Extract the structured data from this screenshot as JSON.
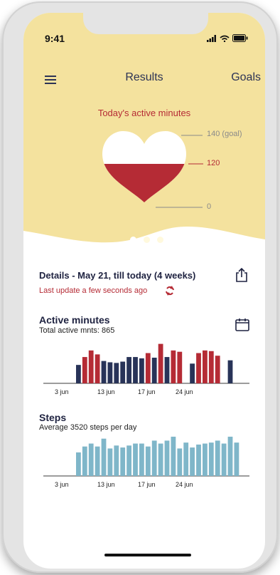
{
  "status": {
    "time": "9:41"
  },
  "nav": {
    "title": "Results",
    "goals_label": "Goals"
  },
  "hero": {
    "title": "Today's active minutes",
    "goal_label": "140 (goal)",
    "current_label": "120",
    "zero_label": "0",
    "current_value": 120,
    "goal_value": 140,
    "pages": 3,
    "active_page": 0
  },
  "details": {
    "title": "Details - May 21, till today (4 weeks)",
    "update": "Last update a few seconds ago"
  },
  "active": {
    "title": "Active minutes",
    "subtitle": "Total active mnts: 865"
  },
  "steps": {
    "title": "Steps",
    "subtitle": "Average 3520 steps per day"
  },
  "colors": {
    "hero_bg": "#f4e29e",
    "red": "#b52b35",
    "navy": "#283358",
    "teal": "#7fb6c9"
  },
  "chart_data": [
    {
      "type": "bar",
      "x_tick_labels": [
        "3 jun",
        "13 jun",
        "17 jun",
        "24 jun"
      ],
      "series": [
        {
          "color": "#283358",
          "values": [
            28,
            0,
            0,
            0,
            34,
            32,
            31,
            33,
            40,
            40,
            38,
            0,
            39,
            0,
            40,
            0,
            0,
            0,
            30,
            0,
            0,
            0,
            0,
            0,
            35,
            0,
            0,
            0,
            0,
            0,
            0,
            0
          ]
        },
        {
          "color": "#b52b35",
          "values": [
            0,
            40,
            50,
            44,
            0,
            0,
            0,
            0,
            0,
            0,
            0,
            46,
            0,
            60,
            0,
            50,
            48,
            0,
            0,
            46,
            50,
            49,
            42,
            0,
            0,
            0,
            0,
            0,
            0,
            0,
            0,
            0
          ]
        }
      ],
      "ylim": [
        0,
        65
      ]
    },
    {
      "type": "bar",
      "x_tick_labels": [
        "3 jun",
        "13 jun",
        "17 jun",
        "24 jun"
      ],
      "series": [
        {
          "color": "#7fb6c9",
          "values": [
            24,
            30,
            33,
            30,
            38,
            28,
            31,
            29,
            31,
            33,
            33,
            30,
            36,
            33,
            36,
            40,
            28,
            34,
            29,
            32,
            33,
            34,
            36,
            33,
            40,
            34
          ]
        }
      ],
      "ylim": [
        0,
        45
      ]
    }
  ]
}
